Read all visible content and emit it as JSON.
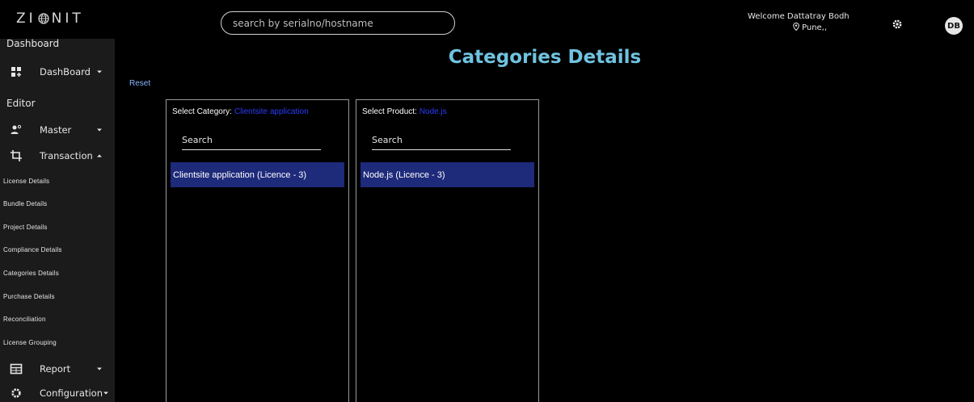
{
  "header": {
    "logo_text_left": "ZI",
    "logo_text_right": "NIT",
    "search": {
      "placeholder": "search by serialno/hostname"
    },
    "welcome_text": "Welcome Dattatray Bodh",
    "location_text": "Pune,,",
    "avatar_initials": "DB"
  },
  "sidebar": {
    "section_dashboard": "Dashboard",
    "dashboard_item": "DashBoard",
    "section_editor": "Editor",
    "master_item": "Master",
    "transaction_item": "Transaction",
    "sub_items": [
      "License Details",
      "Bundle Details",
      "Project Details",
      "Compliance Details",
      "Categories Details",
      "Purchase Details",
      "Reconciliation",
      "License Grouping"
    ],
    "report_item": "Report",
    "configuration_item": "Configuration"
  },
  "main": {
    "title": "Categories Details",
    "reset_label": "Reset",
    "category_panel": {
      "heading": "Select Category:",
      "selected": "Clientsite application",
      "search_placeholder": "Search",
      "option": "Clientsite application (Licence - 3)"
    },
    "product_panel": {
      "heading": "Select Product:",
      "selected": "Node.js",
      "search_placeholder": "Search",
      "option": "Node.js (Licence - 3)"
    }
  },
  "colors": {
    "title": "#6fc3e0",
    "selection_text": "#2a3cff",
    "option_bg": "#1e2a7a",
    "sidebar_bg": "#1b1b1b",
    "link": "#8ab4ff"
  }
}
